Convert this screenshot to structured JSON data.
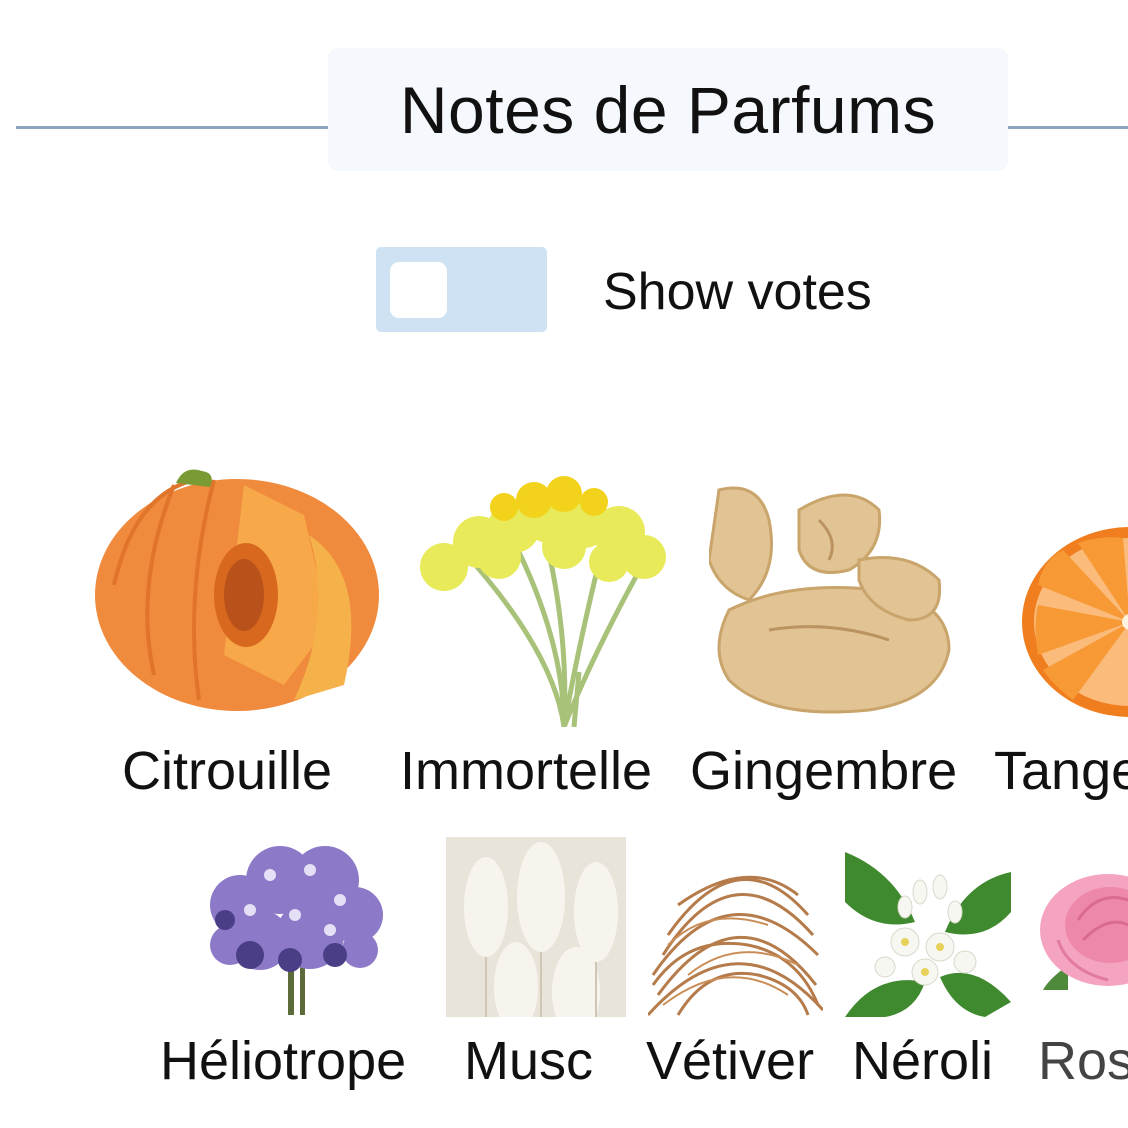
{
  "header": {
    "title": "Notes de Parfums",
    "rule_color": "#8aa6bf",
    "box_color": "#f5f8fc"
  },
  "toggle": {
    "label": "Show votes",
    "state": "off",
    "track_color": "#cfe2f3"
  },
  "notes": {
    "row1": [
      {
        "name": "Citrouille",
        "icon": "pumpkin-image"
      },
      {
        "name": "Immortelle",
        "icon": "immortelle-flower-image"
      },
      {
        "name": "Gingembre",
        "icon": "ginger-root-image"
      },
      {
        "name": "Tange",
        "icon": "tangerine-image"
      }
    ],
    "row2": [
      {
        "name": "Héliotrope",
        "icon": "heliotrope-flower-image"
      },
      {
        "name": "Musc",
        "icon": "musk-image"
      },
      {
        "name": "Vétiver",
        "icon": "vetiver-image"
      },
      {
        "name": "Néroli",
        "icon": "neroli-flower-image"
      },
      {
        "name": "Ros",
        "icon": "rose-image"
      }
    ]
  }
}
